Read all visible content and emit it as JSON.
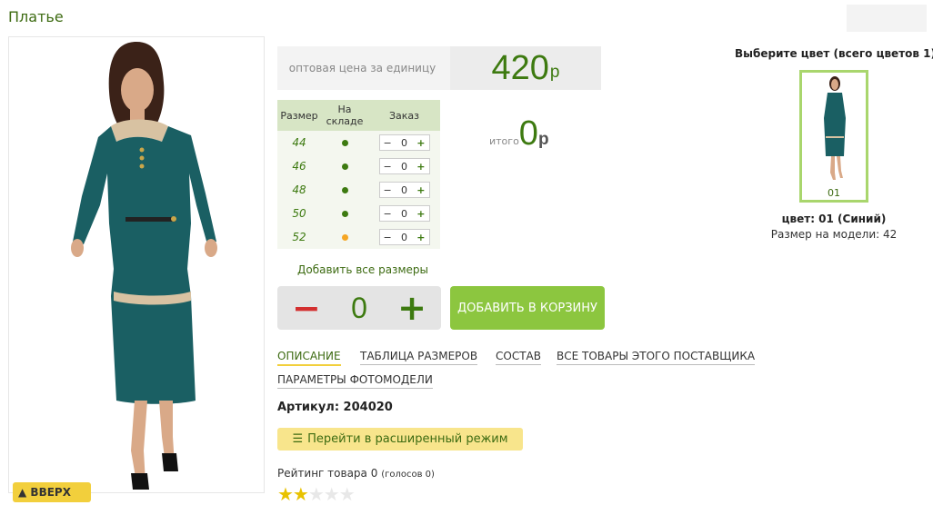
{
  "product": {
    "title": "Платье",
    "article": "Артикул: 204020"
  },
  "price": {
    "label": "оптовая цена за единицу",
    "value": "420",
    "currency": "р"
  },
  "sizes_table": {
    "headers": {
      "size": "Размер",
      "stock": "На складе",
      "order": "Заказ"
    },
    "rows": [
      {
        "size": "44",
        "stock_color": "#3d7a10",
        "qty": "0"
      },
      {
        "size": "46",
        "stock_color": "#3d7a10",
        "qty": "0"
      },
      {
        "size": "48",
        "stock_color": "#3d7a10",
        "qty": "0"
      },
      {
        "size": "50",
        "stock_color": "#3d7a10",
        "qty": "0"
      },
      {
        "size": "52",
        "stock_color": "#f5a623",
        "qty": "0"
      }
    ],
    "minus": "−",
    "plus": "+"
  },
  "total": {
    "label": "итого",
    "value": "0",
    "currency": "р"
  },
  "add_all_sizes": "Добавить все размеры",
  "quantity": {
    "minus": "−",
    "value": "0",
    "plus": "+"
  },
  "add_to_cart": "ДОБАВИТЬ В КОРЗИНУ",
  "tabs": [
    {
      "label": "ОПИСАНИЕ",
      "active": true
    },
    {
      "label": "ТАБЛИЦА РАЗМЕРОВ"
    },
    {
      "label": "СОСТАВ"
    },
    {
      "label": "ВСЕ ТОВАРЫ ЭТОГО ПОСТАВЩИКА"
    },
    {
      "label": "ПАРАМЕТРЫ ФОТОМОДЕЛИ"
    }
  ],
  "extended_mode": "Перейти в расширенный режим",
  "rating": {
    "label": "Рейтинг товара",
    "value": "0",
    "votes": "(голосов 0)",
    "stars": "★★",
    "stars_off": "★★★"
  },
  "back_to_top": "ВВЕРХ",
  "colors": {
    "header": "Выберите цвет (всего цветов 1)",
    "selected_code": "01",
    "selected_name": "цвет: 01 (Синий)",
    "model_size": "Размер на модели: 42"
  },
  "theme": {
    "accent_green": "#3d7a10",
    "button_green": "#8cc63f",
    "yellow": "#f2cf3c",
    "dress_teal": "#1a5f63"
  }
}
